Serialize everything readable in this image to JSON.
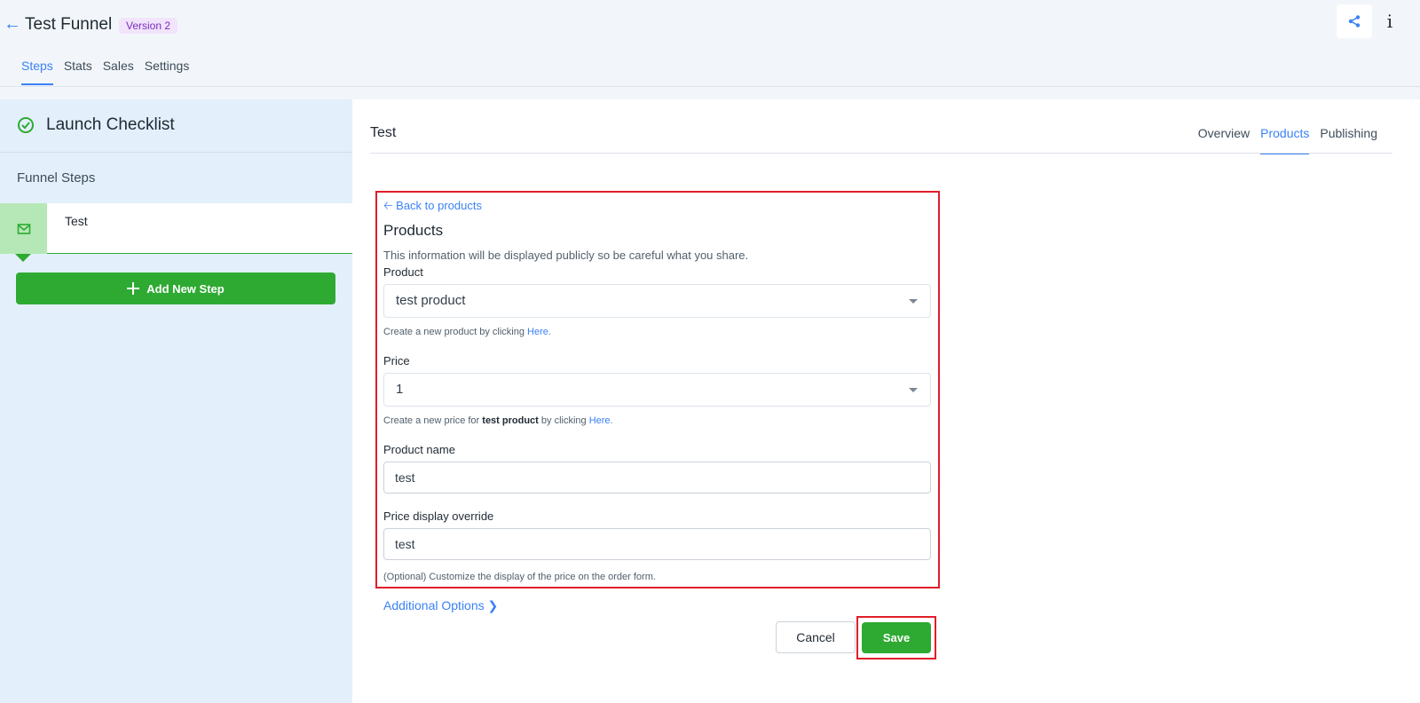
{
  "header": {
    "title": "Test Funnel",
    "version_badge": "Version 2",
    "tabs": [
      {
        "label": "Steps",
        "active": true
      },
      {
        "label": "Stats",
        "active": false
      },
      {
        "label": "Sales",
        "active": false
      },
      {
        "label": "Settings",
        "active": false
      }
    ],
    "share_icon": "share-icon",
    "info_icon": "info-icon",
    "info_glyph": "i"
  },
  "sidebar": {
    "checklist_label": "Launch Checklist",
    "steps_header": "Funnel Steps",
    "steps": [
      {
        "label": "Test",
        "icon": "mail-icon"
      }
    ],
    "add_step_label": "Add New Step"
  },
  "main": {
    "step_title": "Test",
    "tabs": [
      {
        "label": "Overview",
        "active": false
      },
      {
        "label": "Products",
        "active": true
      },
      {
        "label": "Publishing",
        "active": false
      }
    ]
  },
  "form": {
    "back_link": "Back to products",
    "heading": "Products",
    "description": "This information will be displayed publicly so be careful what you share.",
    "product_label": "Product",
    "product_value": "test product",
    "product_help_prefix": "Create a new product by clicking ",
    "product_help_link": "Here.",
    "price_label": "Price",
    "price_value": "1",
    "price_help_prefix": "Create a new price for ",
    "price_help_product": "test product",
    "price_help_suffix": " by clicking ",
    "price_help_link": "Here.",
    "product_name_label": "Product name",
    "product_name_value": "test",
    "price_override_label": "Price display override",
    "price_override_value": "test",
    "price_override_help": "(Optional) Customize the display of the price on the order form.",
    "additional_options": "Additional Options",
    "cancel_label": "Cancel",
    "save_label": "Save"
  },
  "colors": {
    "accent": "#3b82f6",
    "success": "#2eaa32",
    "highlight_border": "#e11d2a",
    "badge_bg": "#f1e4fb",
    "badge_text": "#7b2cbf"
  }
}
